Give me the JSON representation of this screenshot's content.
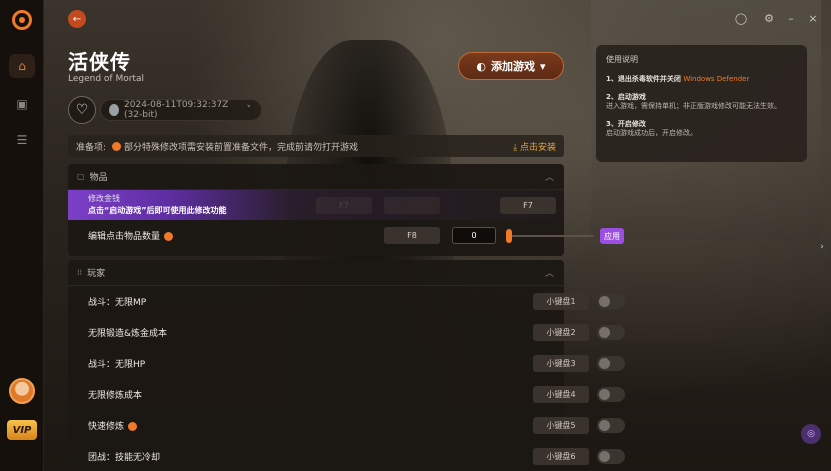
{
  "game": {
    "title": "活侠传",
    "subtitle": "Legend of Mortal",
    "version": "2024-08-11T09:32:37Z (32-bit)"
  },
  "header": {
    "add_game_label": "添加游戏"
  },
  "prep": {
    "label": "准备项:",
    "text": "部分特殊修改项需安装前置准备文件，完成前请勿打开游戏",
    "install_label": "点击安装"
  },
  "items_section": {
    "title": "物品",
    "money": {
      "label": "修改金钱",
      "hint": "点击“启动游戏”后即可使用此修改功能",
      "key_dim_1": "F7",
      "key_dim_2": "",
      "key": "F7"
    },
    "quantity": {
      "label": "编辑点击物品数量",
      "key": "F8",
      "value": "0",
      "apply_label": "应用",
      "slider_fraction": 0.0
    }
  },
  "player_section": {
    "title": "玩家",
    "rows": [
      {
        "label": "战斗：无限MP",
        "hotkey": "小键盘1",
        "dot": false
      },
      {
        "label": "无限锻造&炼金成本",
        "hotkey": "小键盘2",
        "dot": false
      },
      {
        "label": "战斗：无限HP",
        "hotkey": "小键盘3",
        "dot": false
      },
      {
        "label": "无限修炼成本",
        "hotkey": "小键盘4",
        "dot": false
      },
      {
        "label": "快速修炼",
        "hotkey": "小键盘5",
        "dot": true
      },
      {
        "label": "团战：技能无冷却",
        "hotkey": "小键盘6",
        "dot": false
      }
    ]
  },
  "instructions": {
    "title": "使用说明",
    "step1_title": "1、退出杀毒软件并关闭",
    "step1_highlight": "Windows Defender",
    "step2_title": "2、启动游戏",
    "step2_body": "进入游戏，需保持单机；非正版游戏修改可能无法生效。",
    "step3_title": "3、开启修改",
    "step3_body": "启动游戏成功后，开启修改。"
  },
  "rail": {
    "vip_label": "VIP"
  },
  "colors": {
    "accent": "#f07a28",
    "purple": "#9b4fe0"
  }
}
